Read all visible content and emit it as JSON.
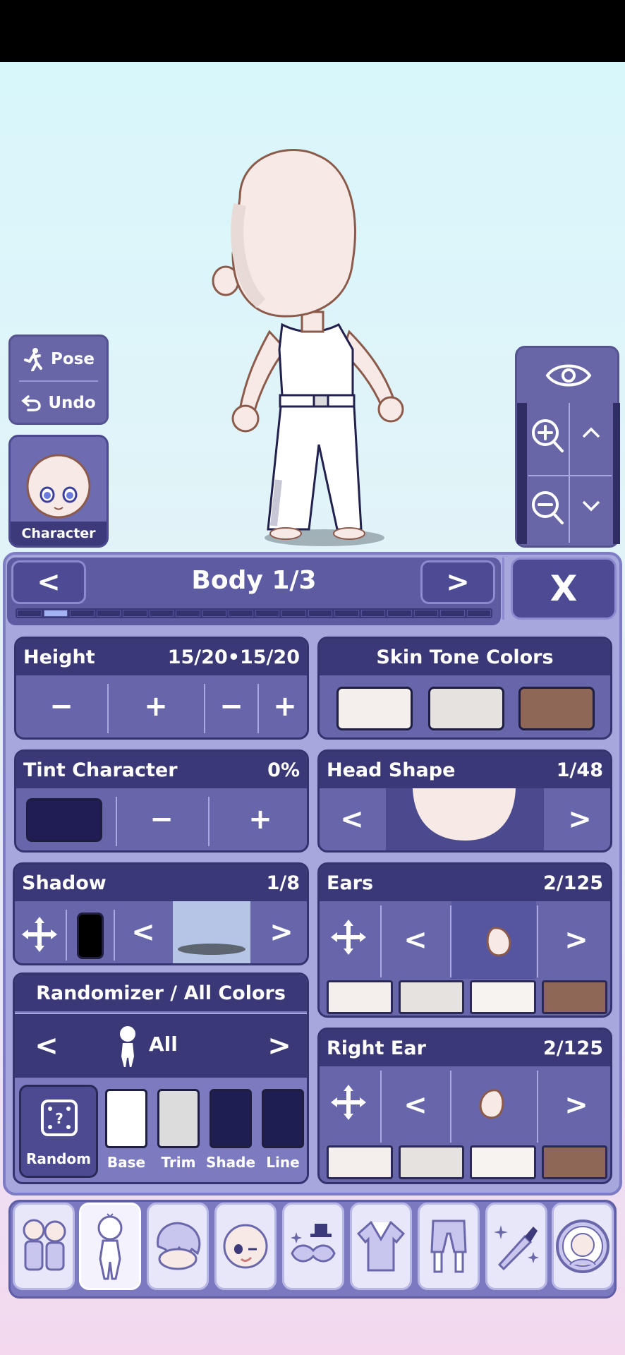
{
  "left": {
    "pose_label": "Pose",
    "undo_label": "Undo",
    "character_label": "Character"
  },
  "header": {
    "title": "Body 1/3",
    "prev": "<",
    "next": ">",
    "close": "X",
    "progress_segments": 18,
    "progress_active": 2
  },
  "height": {
    "label": "Height",
    "value": "15/20•15/20",
    "buttons": [
      "−",
      "+",
      "−",
      "+"
    ]
  },
  "skin": {
    "label": "Skin Tone Colors",
    "colors": [
      "#f4eeec",
      "#e6e2e0",
      "#8f6757"
    ]
  },
  "tint": {
    "label": "Tint Character",
    "value": "0%",
    "color": "#1f1d54",
    "minus": "−",
    "plus": "+"
  },
  "head": {
    "label": "Head Shape",
    "value": "1/48",
    "prev": "<",
    "next": ">"
  },
  "shadow": {
    "label": "Shadow",
    "value": "1/8",
    "prev": "<",
    "next": ">",
    "color": "#000000"
  },
  "ears": {
    "label": "Ears",
    "value": "2/125",
    "prev": "<",
    "next": ">",
    "colors": [
      "#f4eeec",
      "#e6e2e0",
      "#f7f3f1",
      "#8f6757"
    ]
  },
  "right_ear": {
    "label": "Right Ear",
    "value": "2/125",
    "prev": "<",
    "next": ">",
    "colors": [
      "#f4eeec",
      "#e6e2e0",
      "#f7f3f1",
      "#8f6757"
    ]
  },
  "randomizer": {
    "label": "Randomizer / All Colors",
    "mode": "All",
    "prev": "<",
    "next": ">",
    "random_label": "Random",
    "swatches": [
      {
        "label": "Base",
        "color": "#ffffff"
      },
      {
        "label": "Trim",
        "color": "#dcdcdc"
      },
      {
        "label": "Shade",
        "color": "#1f1e52"
      },
      {
        "label": "Line",
        "color": "#1f1e52"
      }
    ]
  },
  "toolbar": {
    "selected_index": 1,
    "items": [
      "presets-icon",
      "body-icon",
      "hair-icon",
      "face-icon",
      "accessories-icon",
      "top-icon",
      "bottom-icon",
      "props-icon",
      "profile-icon"
    ]
  }
}
